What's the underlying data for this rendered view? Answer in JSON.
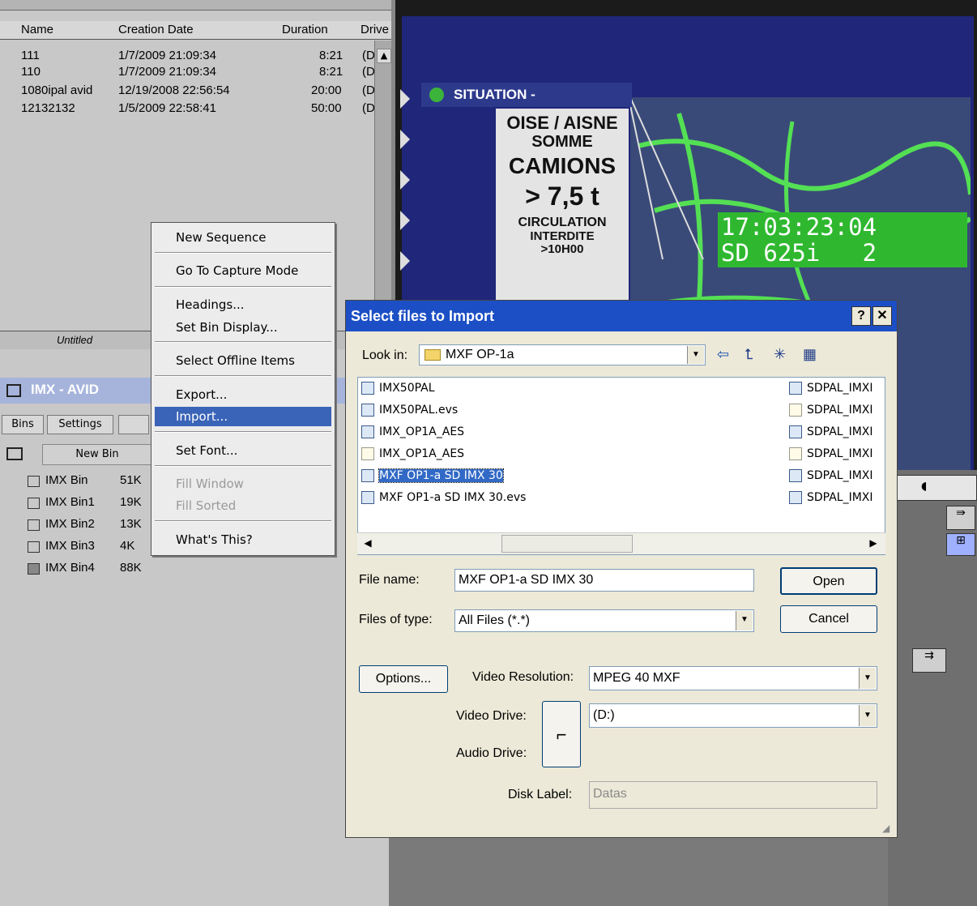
{
  "bin_list": {
    "columns": [
      "Name",
      "Creation Date",
      "Duration",
      "Drive"
    ],
    "rows": [
      {
        "name": "111",
        "date": "1/7/2009 21:09:34",
        "duration": "8:21",
        "drive": "(D"
      },
      {
        "name": "110",
        "date": "1/7/2009 21:09:34",
        "duration": "8:21",
        "drive": "(D"
      },
      {
        "name": "1080ipal avid",
        "date": "12/19/2008 22:56:54",
        "duration": "20:00",
        "drive": "(D"
      },
      {
        "name": "12132132",
        "date": "1/5/2009 22:58:41",
        "duration": "50:00",
        "drive": "(D"
      }
    ],
    "status_text": "Untitled"
  },
  "project": {
    "title": "IMX - AVID",
    "tabs": [
      "Bins",
      "Settings"
    ],
    "new_bin_label": "New Bin",
    "bins": [
      {
        "name": "IMX Bin",
        "size": "51K"
      },
      {
        "name": "IMX Bin1",
        "size": "19K"
      },
      {
        "name": "IMX Bin2",
        "size": "13K"
      },
      {
        "name": "IMX Bin3",
        "size": "4K"
      },
      {
        "name": "IMX Bin4",
        "size": "88K"
      }
    ]
  },
  "context_menu": {
    "items": [
      {
        "label": "New Sequence"
      },
      {
        "label": "Go To Capture Mode"
      },
      {
        "label": "Headings..."
      },
      {
        "label": "Set Bin Display..."
      },
      {
        "label": "Select Offline Items"
      },
      {
        "label": "Export..."
      },
      {
        "label": "Import..."
      },
      {
        "label": "Set Font..."
      },
      {
        "label": "Fill Window"
      },
      {
        "label": "Fill Sorted"
      },
      {
        "label": "What's This?"
      }
    ],
    "selected": "Import...",
    "disabled": [
      "Fill Window",
      "Fill Sorted"
    ]
  },
  "monitor": {
    "banner": "SITUATION  -",
    "sign_lines": [
      "OISE / AISNE",
      "SOMME",
      "CAMIONS",
      "> 7,5 t",
      "CIRCULATION",
      "INTERDITE",
      ">10H00"
    ],
    "timecode_line1": "17:03:23:04",
    "timecode_line2": "SD 625i   2"
  },
  "dialog": {
    "title": "Select files to Import",
    "help_label": "?",
    "close_label": "✕",
    "look_in_label": "Look in:",
    "look_in_value": "MXF OP-1a",
    "files_left": [
      {
        "name": "IMX50PAL",
        "kind": "media"
      },
      {
        "name": "IMX50PAL.evs",
        "kind": "evs"
      },
      {
        "name": "IMX_OP1A_AES",
        "kind": "media"
      },
      {
        "name": "IMX_OP1A_AES",
        "kind": "doc"
      },
      {
        "name": "MXF OP1-a SD IMX 30",
        "kind": "media"
      },
      {
        "name": "MXF OP1-a SD IMX 30.evs",
        "kind": "evs"
      }
    ],
    "files_right": [
      {
        "name": "SDPAL_IMXI",
        "kind": "media"
      },
      {
        "name": "SDPAL_IMXI",
        "kind": "doc"
      },
      {
        "name": "SDPAL_IMXI",
        "kind": "media"
      },
      {
        "name": "SDPAL_IMXI",
        "kind": "doc"
      },
      {
        "name": "SDPAL_IMXI",
        "kind": "media"
      },
      {
        "name": "SDPAL_IMXI",
        "kind": "media"
      }
    ],
    "selected_file": "MXF OP1-a SD IMX 30",
    "file_name_label": "File name:",
    "file_name_value": "MXF OP1-a SD IMX 30",
    "files_of_type_label": "Files of type:",
    "files_of_type_value": "All Files (*.*)",
    "open_label": "Open",
    "cancel_label": "Cancel",
    "options_label": "Options...",
    "video_resolution_label": "Video Resolution:",
    "video_resolution_value": "MPEG 40  MXF",
    "video_drive_label": "Video Drive:",
    "video_drive_value": "(D:)",
    "audio_drive_label": "Audio Drive:",
    "disk_label_label": "Disk Label:",
    "disk_label_value": "Datas"
  },
  "colors": {
    "dialog_caption": "#1c4fc5",
    "menu_highlight": "#3a64b8",
    "timecode_bg": "#2fb82f"
  }
}
